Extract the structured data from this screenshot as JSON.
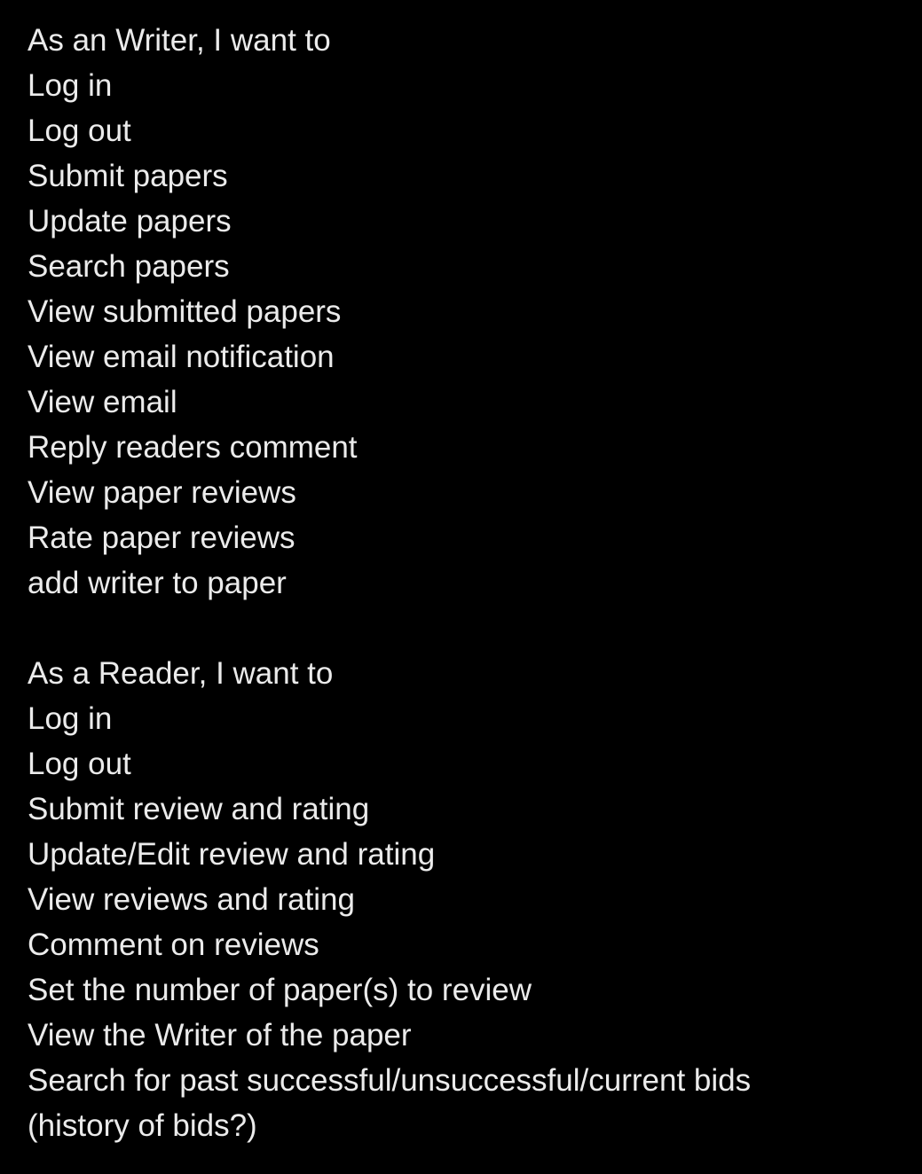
{
  "sections": [
    {
      "heading": "As an Writer, I want to",
      "items": [
        "Log in",
        "Log out",
        "Submit papers",
        "Update papers",
        "Search papers",
        "View submitted papers",
        "View email notification",
        "View email",
        "Reply readers comment",
        "View paper reviews",
        "Rate paper reviews",
        "add writer to paper"
      ]
    },
    {
      "heading": "As a Reader, I want to",
      "items": [
        "Log in",
        "Log out",
        "Submit review and rating",
        "Update/Edit review and rating",
        "View reviews and rating",
        "Comment on reviews",
        "Set the number of paper(s) to review",
        "View the Writer of the paper",
        "Search for past successful/unsuccessful/current bids",
        "(history of bids?)"
      ]
    }
  ]
}
